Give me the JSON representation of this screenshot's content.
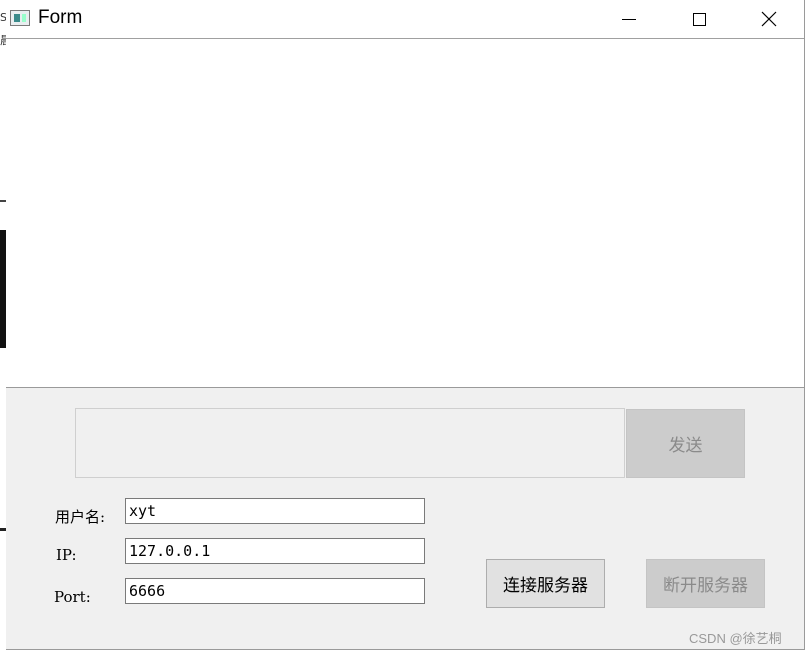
{
  "window": {
    "title": "Form"
  },
  "send_button_label": "发送",
  "form": {
    "username_label": "用户名:",
    "username_value": "xyt",
    "ip_label": "IP:",
    "ip_value": "127.0.0.1",
    "port_label": "Port:",
    "port_value": "6666"
  },
  "buttons": {
    "connect_label": "连接服务器",
    "disconnect_label": "断开服务器"
  },
  "watermark": "CSDN @徐艺桐",
  "background_fragments": [
    "S",
    "晨"
  ]
}
